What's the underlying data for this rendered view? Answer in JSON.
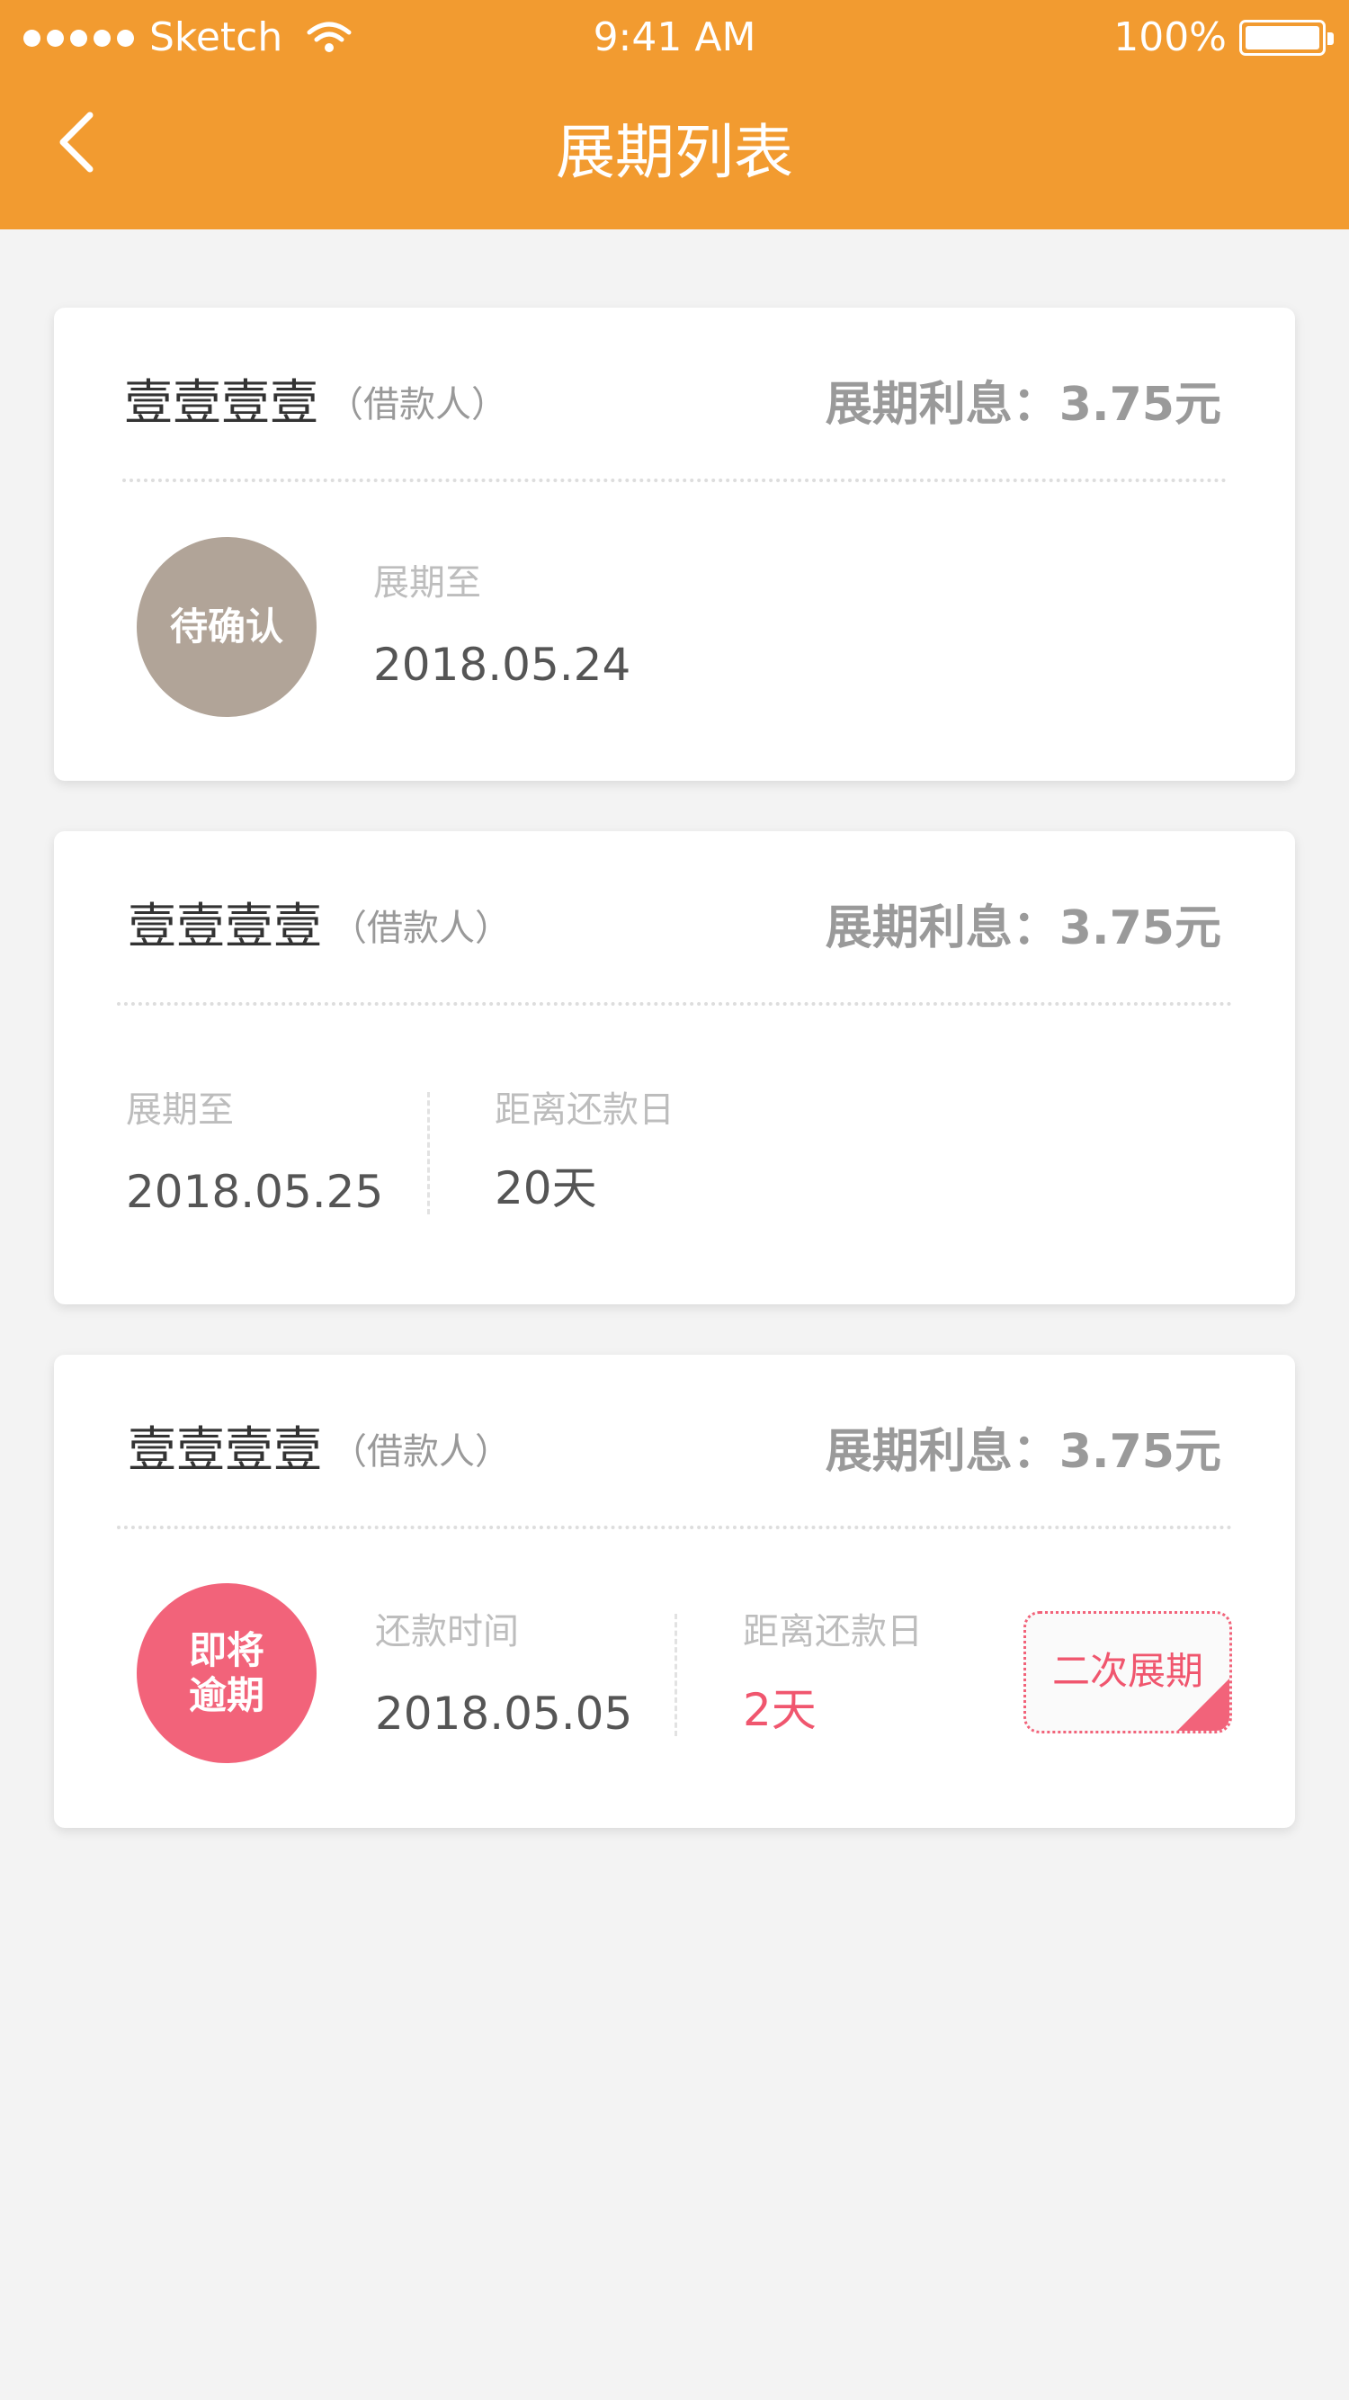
{
  "status_bar": {
    "carrier": "Sketch",
    "time": "9:41 AM",
    "battery": "100%"
  },
  "header": {
    "title": "展期列表"
  },
  "colors": {
    "header": "#f29b30",
    "pending": "#b1a498",
    "overdue": "#f2637a"
  },
  "cards": [
    {
      "name": "壹壹壹壹",
      "role": "（借款人）",
      "interest": "展期利息：3.75元",
      "status": "待确认",
      "ext_label": "展期至",
      "ext_value": "2018.05.24"
    },
    {
      "name": "壹壹壹壹",
      "role": "（借款人）",
      "interest": "展期利息：3.75元",
      "ext_label": "展期至",
      "ext_value": "2018.05.25",
      "days_label": "距离还款日",
      "days_value": "20天"
    },
    {
      "name": "壹壹壹壹",
      "role": "（借款人）",
      "interest": "展期利息：3.75元",
      "status_line1": "即将",
      "status_line2": "逾期",
      "repay_label": "还款时间",
      "repay_value": "2018.05.05",
      "days_label": "距离还款日",
      "days_value": "2天",
      "action": "二次展期"
    }
  ]
}
